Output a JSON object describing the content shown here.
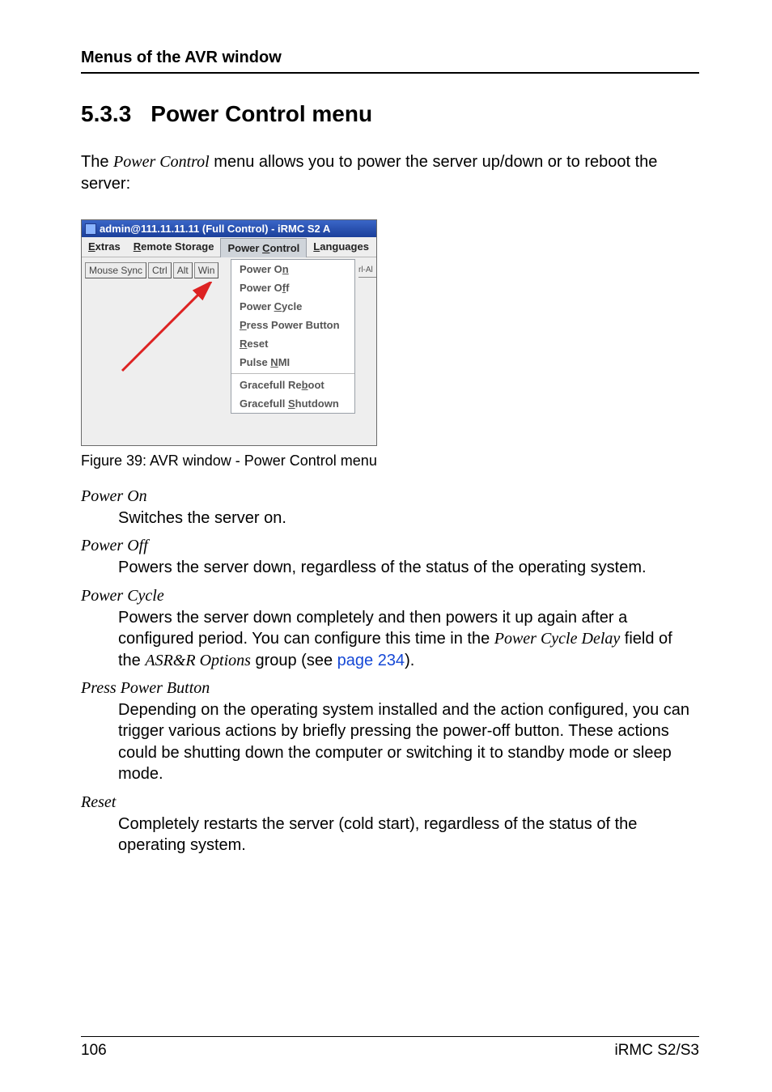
{
  "header": {
    "running_head": "Menus of the AVR window"
  },
  "section": {
    "num": "5.3.3",
    "title": "Power Control menu"
  },
  "intro": {
    "pre": "The ",
    "em": "Power Control",
    "post": " menu allows you to power the server up/down or to reboot the server:"
  },
  "avr": {
    "titlebar": "admin@111.11.11.11 (Full Control) - iRMC S2 A",
    "menubar": {
      "extras": {
        "u": "E",
        "rest": "xtras"
      },
      "remote": {
        "u": "R",
        "rest": "emote Storage"
      },
      "power": {
        "pre": "Power ",
        "u": "C",
        "post": "ontrol"
      },
      "lang": {
        "u": "L",
        "rest": "anguages"
      }
    },
    "toolbar": {
      "mouse_sync": "Mouse Sync",
      "ctrl": "Ctrl",
      "alt": "Alt",
      "win": "Win"
    },
    "right_sliver": "rl-Al",
    "dropdown": {
      "on": {
        "pre": "Power O",
        "u": "n",
        "post": ""
      },
      "off": {
        "pre": "Power O",
        "u": "f",
        "post": "f"
      },
      "cycle": {
        "pre": "Power ",
        "u": "C",
        "post": "ycle"
      },
      "press": {
        "u": "P",
        "post": "ress Power Button"
      },
      "reset": {
        "u": "R",
        "post": "eset"
      },
      "nmi": {
        "pre": "Pulse ",
        "u": "N",
        "post": "MI"
      },
      "greboot": {
        "pre": "Gracefull Re",
        "u": "b",
        "post": "oot"
      },
      "gshutdown": {
        "pre": "Gracefull ",
        "u": "S",
        "post": "hutdown"
      }
    }
  },
  "figure_caption": "Figure 39: AVR window - Power Control menu",
  "defs": {
    "power_on": {
      "term": "Power On",
      "desc": "Switches the server on."
    },
    "power_off": {
      "term": "Power Off",
      "desc": "Powers the server down, regardless of the status of the operating system."
    },
    "power_cycle": {
      "term": "Power Cycle",
      "p1": "Powers the server down completely and then powers it up again after a configured period. You can configure this time in the ",
      "em1": "Power Cycle Delay",
      "p2": " field of the ",
      "em2": "ASR&R Options",
      "p3": " group (see ",
      "link": "page 234",
      "p4": ")."
    },
    "press": {
      "term": "Press Power Button",
      "desc": "Depending on the operating system installed and the action configured, you can trigger various actions by briefly pressing the power-off button. These actions could be shutting down the computer or switching it to standby mode or sleep mode."
    },
    "reset": {
      "term": "Reset",
      "desc": "Completely restarts the server (cold start), regardless of the status of the operating system."
    }
  },
  "footer": {
    "page": "106",
    "product": "iRMC S2/S3"
  }
}
